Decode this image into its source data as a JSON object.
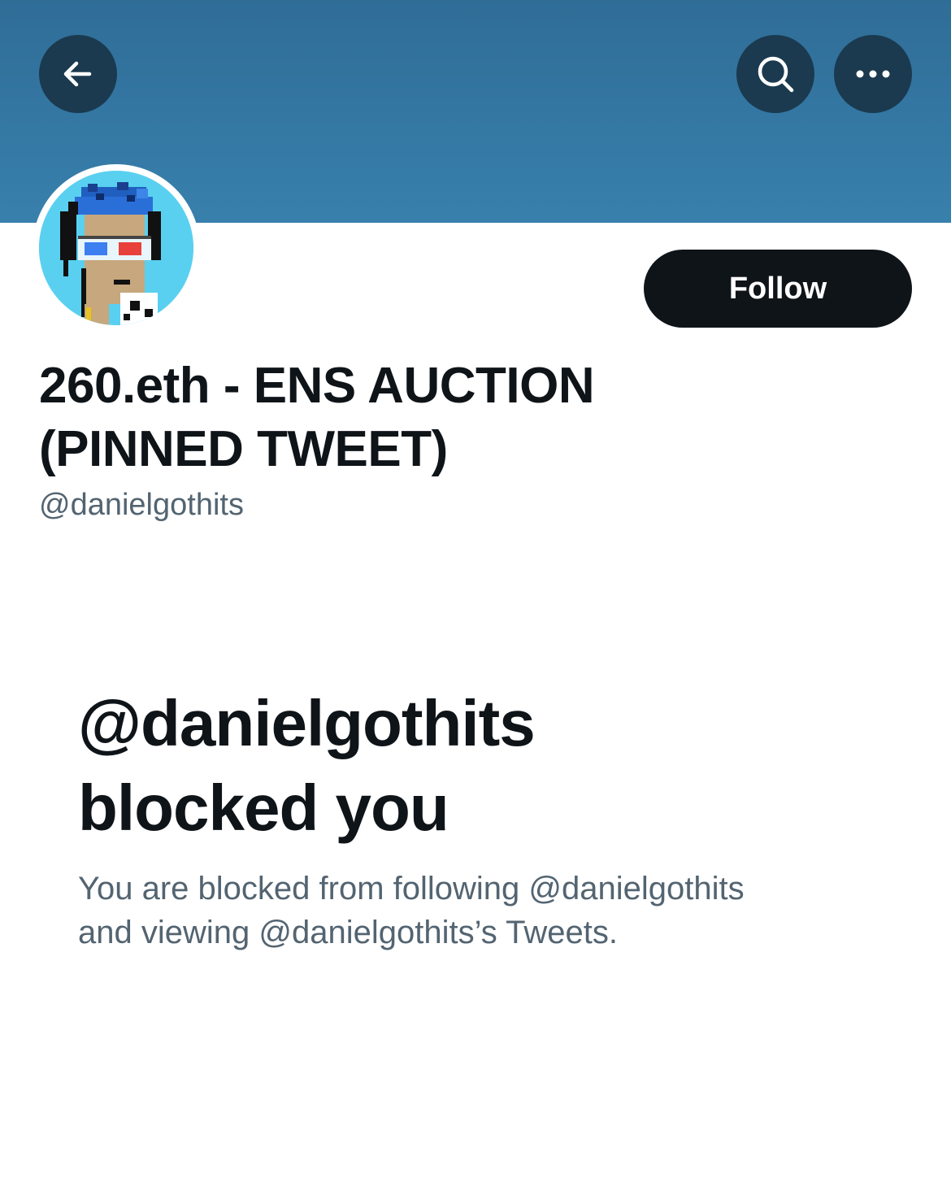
{
  "header": {
    "back_icon": "arrow-left-icon",
    "search_icon": "search-icon",
    "more_icon": "more-horizontal-icon",
    "banner_color": "#3478a5",
    "button_bg": "#1b3a4f"
  },
  "profile": {
    "avatar": "pixel-art-punk-avatar",
    "follow_label": "Follow",
    "name_line1": "260.eth - ENS AUCTION",
    "name_line2": "(PINNED TWEET)",
    "handle": "@danielgothits"
  },
  "blocked": {
    "title_line1": "@danielgothits",
    "title_line2": "blocked you",
    "desc_line1": "You are blocked from following @danielgothits",
    "desc_line2": "and viewing @danielgothits’s Tweets."
  },
  "colors": {
    "text_primary": "#0f1419",
    "text_secondary": "#536471",
    "follow_bg": "#0f1419",
    "follow_text": "#ffffff"
  }
}
